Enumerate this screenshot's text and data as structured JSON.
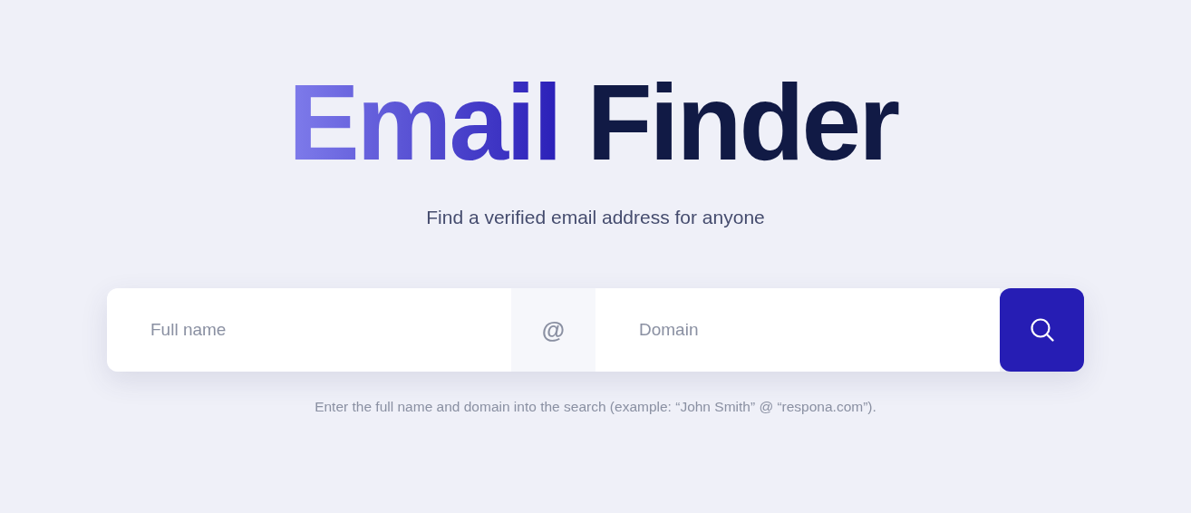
{
  "title": {
    "accent": "Email",
    "main": "Finder"
  },
  "subtitle": "Find a verified email address for anyone",
  "search": {
    "name_placeholder": "Full name",
    "separator": "@",
    "domain_placeholder": "Domain"
  },
  "hint": "Enter the full name and domain into the search (example: “John Smith” @ “respona.com”)."
}
